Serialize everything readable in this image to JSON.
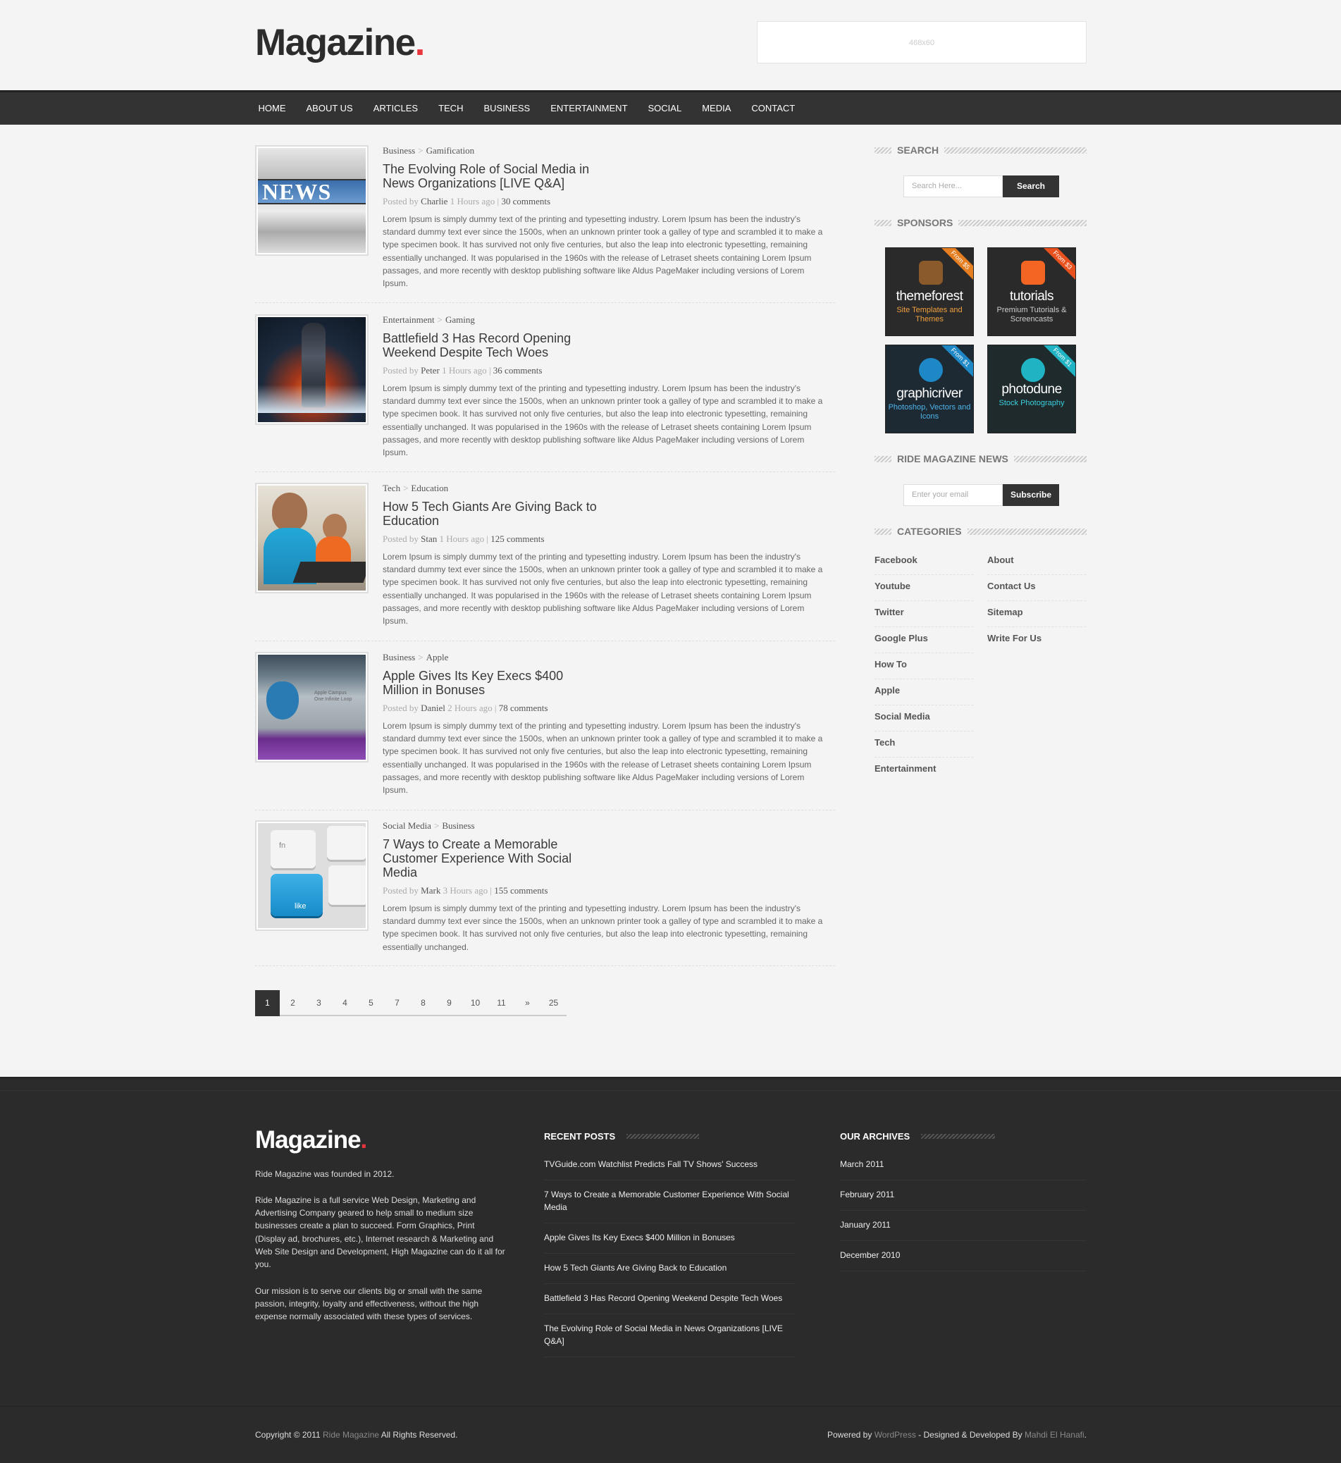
{
  "header": {
    "logo": "Magazine",
    "ad_text": "468x60"
  },
  "nav": [
    "HOME",
    "ABOUT US",
    "ARTICLES",
    "TECH",
    "BUSINESS",
    "ENTERTAINMENT",
    "SOCIAL",
    "MEDIA",
    "CONTACT"
  ],
  "posts": [
    {
      "cat1": "Business",
      "cat2": "Gamification",
      "title": "The Evolving Role of Social Media in News Organizations [LIVE Q&A]",
      "author": "Charlie",
      "time": "1 Hours ago",
      "comments": "30 comments",
      "excerpt": "Lorem Ipsum is simply dummy text of the printing and typesetting industry. Lorem Ipsum has been the industry's standard dummy text ever since the 1500s, when an unknown printer took a galley of type and scrambled it to make a type specimen book. It has survived not only five centuries, but also the leap into electronic typesetting, remaining essentially unchanged. It was popularised in the 1960s with the release of Letraset sheets containing Lorem Ipsum passages, and more recently with desktop publishing software like Aldus PageMaker including versions of Lorem Ipsum.",
      "thumb_text": "NEWS"
    },
    {
      "cat1": "Entertainment",
      "cat2": "Gaming",
      "title": "Battlefield 3 Has Record Opening Weekend Despite Tech Woes",
      "author": "Peter",
      "time": "1 Hours ago",
      "comments": "36 comments",
      "excerpt": "Lorem Ipsum is simply dummy text of the printing and typesetting industry. Lorem Ipsum has been the industry's standard dummy text ever since the 1500s, when an unknown printer took a galley of type and scrambled it to make a type specimen book. It has survived not only five centuries, but also the leap into electronic typesetting, remaining essentially unchanged. It was popularised in the 1960s with the release of Letraset sheets containing Lorem Ipsum passages, and more recently with desktop publishing software like Aldus PageMaker including versions of Lorem Ipsum."
    },
    {
      "cat1": "Tech",
      "cat2": "Education",
      "title": "How 5 Tech Giants Are Giving Back to Education",
      "author": "Stan",
      "time": "1 Hours ago",
      "comments": "125 comments",
      "excerpt": "Lorem Ipsum is simply dummy text of the printing and typesetting industry. Lorem Ipsum has been the industry's standard dummy text ever since the 1500s, when an unknown printer took a galley of type and scrambled it to make a type specimen book. It has survived not only five centuries, but also the leap into electronic typesetting, remaining essentially unchanged. It was popularised in the 1960s with the release of Letraset sheets containing Lorem Ipsum passages, and more recently with desktop publishing software like Aldus PageMaker including versions of Lorem Ipsum."
    },
    {
      "cat1": "Business",
      "cat2": "Apple",
      "title": "Apple Gives Its Key Execs $400 Million in Bonuses",
      "author": "Daniel",
      "time": "2 Hours ago",
      "comments": "78 comments",
      "excerpt": "Lorem Ipsum is simply dummy text of the printing and typesetting industry. Lorem Ipsum has been the industry's standard dummy text ever since the 1500s, when an unknown printer took a galley of type and scrambled it to make a type specimen book. It has survived not only five centuries, but also the leap into electronic typesetting, remaining essentially unchanged. It was popularised in the 1960s with the release of Letraset sheets containing Lorem Ipsum passages, and more recently with desktop publishing software like Aldus PageMaker including versions of Lorem Ipsum.",
      "thumb_text": "Apple Campus One Infinite Loop"
    },
    {
      "cat1": "Social Media",
      "cat2": "Business",
      "title": "7 Ways to Create a Memorable Customer Experience With Social Media",
      "author": "Mark",
      "time": "3 Hours ago",
      "comments": "155 comments",
      "excerpt": "Lorem Ipsum is simply dummy text of the printing and typesetting industry. Lorem Ipsum has been the industry's standard dummy text ever since the 1500s, when an unknown printer took a galley of type and scrambled it to make a type specimen book. It has survived not only five centuries, but also the leap into electronic typesetting, remaining essentially unchanged.",
      "thumb_text": "like",
      "thumb_text2": "fn"
    }
  ],
  "posted_by": "Posted by",
  "pagination": [
    "1",
    "2",
    "3",
    "4",
    "5",
    "7",
    "8",
    "9",
    "10",
    "11",
    "»",
    "25"
  ],
  "sidebar": {
    "search_title": "SEARCH",
    "search_placeholder": "Search Here...",
    "search_button": "Search",
    "sponsors_title": "SPONSORS",
    "sponsors": [
      {
        "name": "themeforest",
        "sub": "Site Templates and Themes",
        "tag": "From $5",
        "color": "#e67e22",
        "subcolor": "#f0a040"
      },
      {
        "name": "tutorials",
        "sub": "Premium Tutorials & Screencasts",
        "tag": "From $3",
        "color": "#e8501e",
        "subcolor": "#ccc"
      },
      {
        "name": "graphicriver",
        "sub": "Photoshop, Vectors and Icons",
        "tag": "From $1",
        "color": "#1e88c7",
        "subcolor": "#4fb5ea"
      },
      {
        "name": "photodune",
        "sub": "Stock Photography",
        "tag": "From $1",
        "color": "#20b3c4",
        "subcolor": "#3bd0dd"
      }
    ],
    "news_title": "RIDE MAGAZINE NEWS",
    "email_placeholder": "Enter your email",
    "subscribe_button": "Subscribe",
    "categories_title": "CATEGORIES",
    "categories_left": [
      "Facebook",
      "Youtube",
      "Twitter",
      "Google Plus",
      "How To",
      "Apple",
      "Social Media",
      "Tech",
      "Entertainment"
    ],
    "categories_right": [
      "About",
      "Contact Us",
      "Sitemap",
      "Write For Us"
    ]
  },
  "footer": {
    "logo": "Magazine",
    "about1": "Ride Magazine was founded in 2012.",
    "about2": "Ride Magazine is a full service Web Design, Marketing and Advertising Company geared to help small to medium size businesses create a plan to succeed. Form Graphics, Print (Display ad, brochures, etc.), Internet research & Marketing and Web Site Design and Development, High Magazine can do it all for you.",
    "about3": "Our mission is to serve our clients big or small with the same passion, integrity, loyalty and effectiveness, without the high expense normally associated with these types of services.",
    "recent_title": "RECENT POSTS",
    "recent": [
      "TVGuide.com Watchlist Predicts Fall TV Shows' Success",
      "7 Ways to Create a Memorable Customer Experience With Social Media",
      "Apple Gives Its Key Execs $400 Million in Bonuses",
      "How 5 Tech Giants Are Giving Back to Education",
      "Battlefield 3 Has Record Opening Weekend Despite Tech Woes",
      "The Evolving Role of Social Media in News Organizations [LIVE Q&A]"
    ],
    "archives_title": "OUR ARCHIVES",
    "archives": [
      "March 2011",
      "February 2011",
      "January 2011",
      "December 2010"
    ],
    "copy_prefix": "Copyright © 2011",
    "copy_link": "Ride Magazine",
    "copy_suffix": "All Rights Reserved.",
    "powered_prefix": "Powered by",
    "powered_link": "WordPress",
    "designed_prefix": "- Designed & Developed By",
    "designer": "Mahdi El Hanafi",
    "designer_suffix": "."
  },
  "colors": {
    "accent": "#e8353b",
    "nav_bg": "#333333",
    "footer_bg": "#2b2b2b"
  }
}
